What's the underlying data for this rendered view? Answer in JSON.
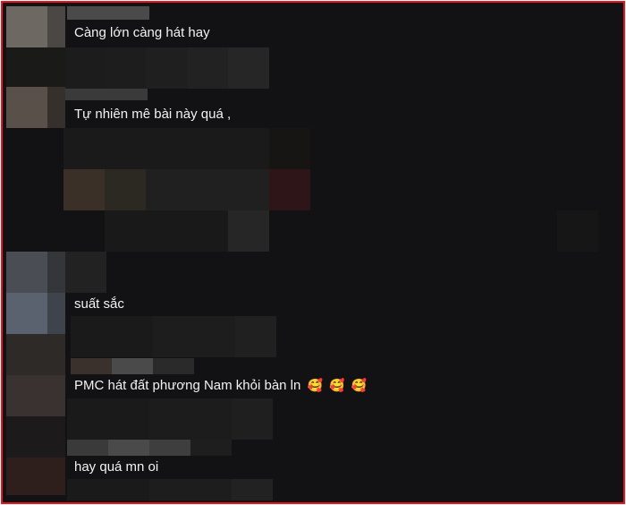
{
  "comments": [
    {
      "text": "Càng lớn càng hát hay"
    },
    {
      "text": "Tự nhiên mê bài này quá ,"
    },
    {
      "text": "suất sắc"
    },
    {
      "text": "PMC hát đất phương Nam khỏi bàn ln",
      "emojis": [
        "🥰",
        "🥰",
        "🥰"
      ]
    },
    {
      "text": "hay quá mn oi"
    }
  ],
  "colors": {
    "border": "#e8141e",
    "background": "#121214",
    "text": "#f2f2f2"
  }
}
